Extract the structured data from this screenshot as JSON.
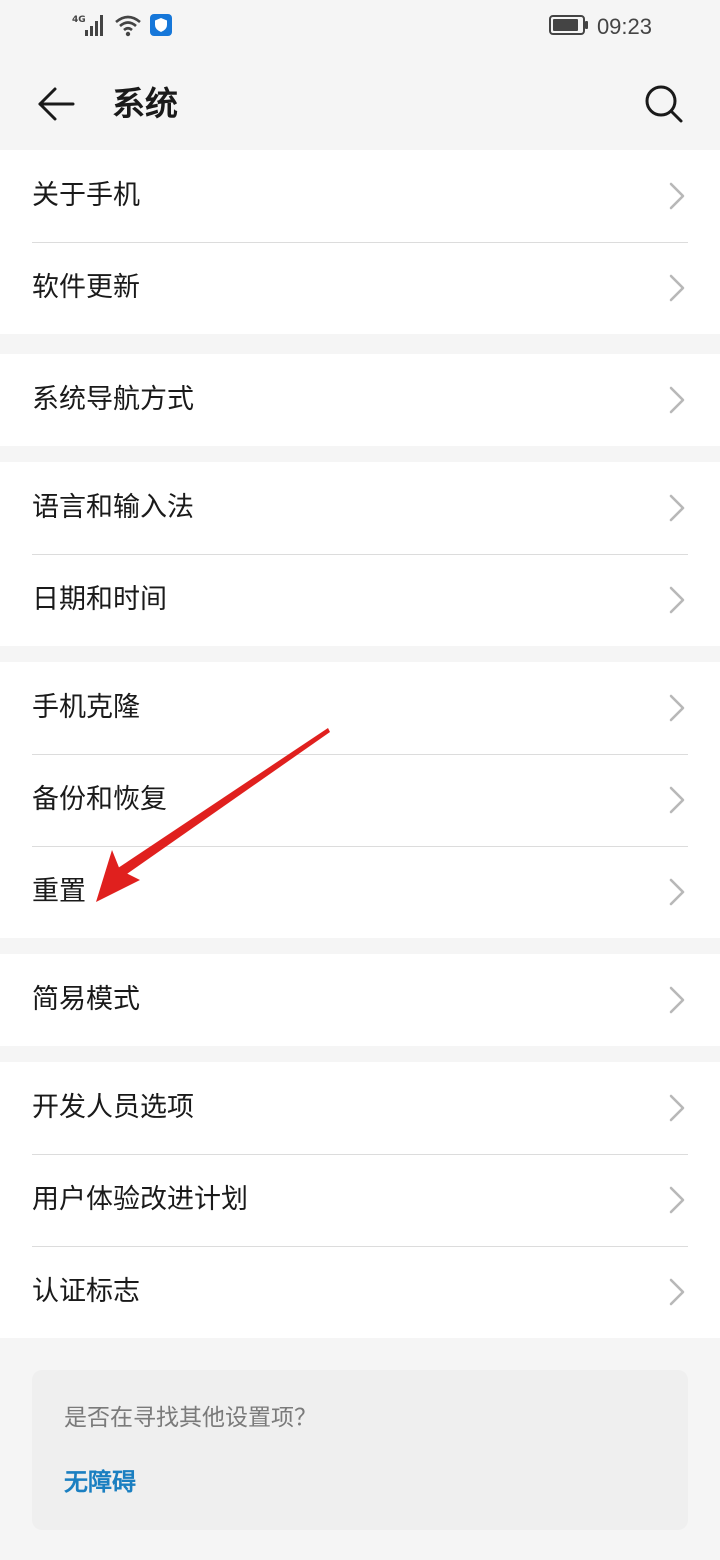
{
  "status_bar": {
    "network": "4G",
    "time": "09:23"
  },
  "header": {
    "title": "系统",
    "back_icon": "arrow-left-icon",
    "search_icon": "search-icon"
  },
  "groups": [
    {
      "items": [
        {
          "label": "关于手机"
        },
        {
          "label": "软件更新"
        }
      ]
    },
    {
      "items": [
        {
          "label": "系统导航方式"
        }
      ]
    },
    {
      "items": [
        {
          "label": "语言和输入法"
        },
        {
          "label": "日期和时间"
        }
      ]
    },
    {
      "items": [
        {
          "label": "手机克隆"
        },
        {
          "label": "备份和恢复"
        },
        {
          "label": "重置"
        }
      ]
    },
    {
      "items": [
        {
          "label": "简易模式"
        }
      ]
    },
    {
      "items": [
        {
          "label": "开发人员选项"
        },
        {
          "label": "用户体验改进计划"
        },
        {
          "label": "认证标志"
        }
      ]
    }
  ],
  "suggestion": {
    "question": "是否在寻找其他设置项？",
    "link": "无障碍"
  },
  "colors": {
    "background": "#f5f5f5",
    "card": "#ffffff",
    "divider": "#dcdcdc",
    "link": "#1a7fc1",
    "annotation_arrow": "#e0201e"
  }
}
